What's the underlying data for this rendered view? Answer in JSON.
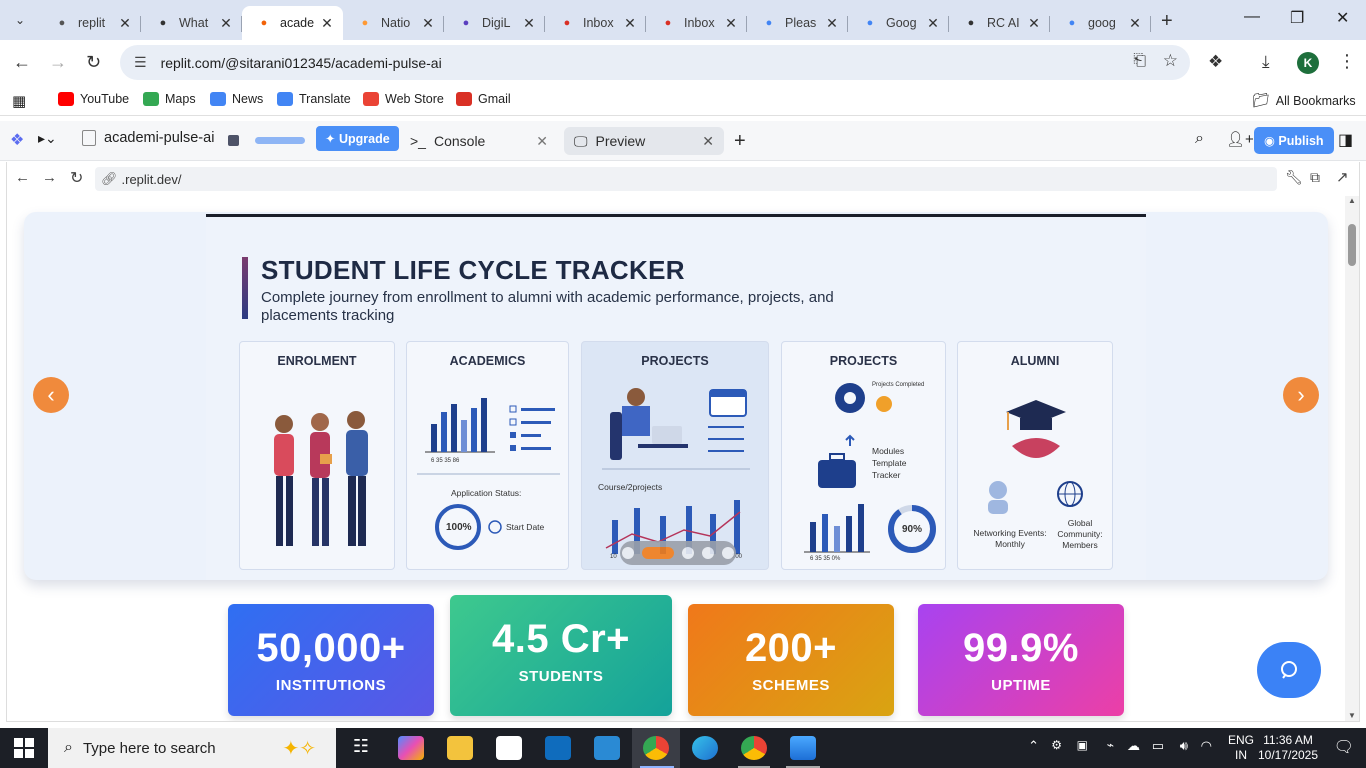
{
  "browser": {
    "tabs": [
      {
        "title": "replit",
        "icon": "replit-icon",
        "color": "#555"
      },
      {
        "title": "What",
        "icon": "chatgpt-icon",
        "color": "#333"
      },
      {
        "title": "acade",
        "icon": "replit-icon",
        "color": "#f26207",
        "active": true
      },
      {
        "title": "Natio",
        "icon": "india-flag-icon",
        "color": "#ff9933"
      },
      {
        "title": "DigiL",
        "icon": "digilocker-icon",
        "color": "#5a3fbf"
      },
      {
        "title": "Inbox",
        "icon": "gmail-icon",
        "color": "#d93025"
      },
      {
        "title": "Inbox",
        "icon": "gmail-icon",
        "color": "#d93025"
      },
      {
        "title": "Pleas",
        "icon": "google-icon",
        "color": "#4285f4"
      },
      {
        "title": "Goog",
        "icon": "gemini-icon",
        "color": "#4285f4"
      },
      {
        "title": "RC AI",
        "icon": "rc-icon",
        "color": "#333"
      },
      {
        "title": "goog",
        "icon": "google-icon",
        "color": "#4285f4"
      }
    ],
    "url": "replit.com/@sitarani012345/academi-pulse-ai",
    "profile_initial": "K",
    "bookmarks": [
      {
        "label": "YouTube",
        "color": "#ff0000"
      },
      {
        "label": "Maps",
        "color": "#34a853"
      },
      {
        "label": "News",
        "color": "#4285f4"
      },
      {
        "label": "Translate",
        "color": "#4285f4"
      },
      {
        "label": "Web Store",
        "color": "#ea4335"
      },
      {
        "label": "Gmail",
        "color": "#d93025"
      }
    ],
    "all_bookmarks": "All Bookmarks"
  },
  "replit": {
    "project_name": "academi-pulse-ai",
    "upgrade_label": "Upgrade",
    "console_label": "Console",
    "preview_label": "Preview",
    "publish_label": "Publish",
    "preview_url": ".replit.dev/"
  },
  "slide": {
    "title": "STUDENT LIFE CYCLE TRACKER",
    "subtitle": "Complete journey from enrollment to alumni with academic performance, projects, and placements tracking",
    "panels": [
      {
        "heading": "ENROLMENT"
      },
      {
        "heading": "ACADEMICS",
        "status_label": "Application Status:",
        "percent": "100%",
        "start_date": "Start Date",
        "ticks": "6   35   35   86"
      },
      {
        "heading": "PROJECTS",
        "chart_label": "Course/2projects",
        "axis_start": "10",
        "axis_end": "200"
      },
      {
        "heading": "PROJECTS",
        "projects_completed": "Projects Completed",
        "modules_line1": "Modules",
        "modules_line2": "Template",
        "modules_line3": "Tracker",
        "percent": "90%",
        "ticks": "6   35   35   0%"
      },
      {
        "heading": "ALUMNI",
        "networking": "Networking Events: Monthly",
        "global": "Global Community: Members"
      }
    ],
    "active_dot": 1,
    "dot_count": 5
  },
  "stats": [
    {
      "value": "50,000+",
      "label": "INSTITUTIONS",
      "grad_from": "#2f6ff2",
      "grad_to": "#5a57e6"
    },
    {
      "value": "4.5 Cr+",
      "label": "STUDENTS",
      "grad_from": "#3ec98e",
      "grad_to": "#14a29a"
    },
    {
      "value": "200+",
      "label": "SCHEMES",
      "grad_from": "#f0781a",
      "grad_to": "#d9a412"
    },
    {
      "value": "99.9%",
      "label": "UPTIME",
      "grad_from": "#a843f0",
      "grad_to": "#ec3fa6"
    }
  ],
  "taskbar": {
    "search_placeholder": "Type here to search",
    "lang_line1": "ENG",
    "lang_line2": "IN",
    "time": "11:36 AM",
    "date": "10/17/2025"
  }
}
